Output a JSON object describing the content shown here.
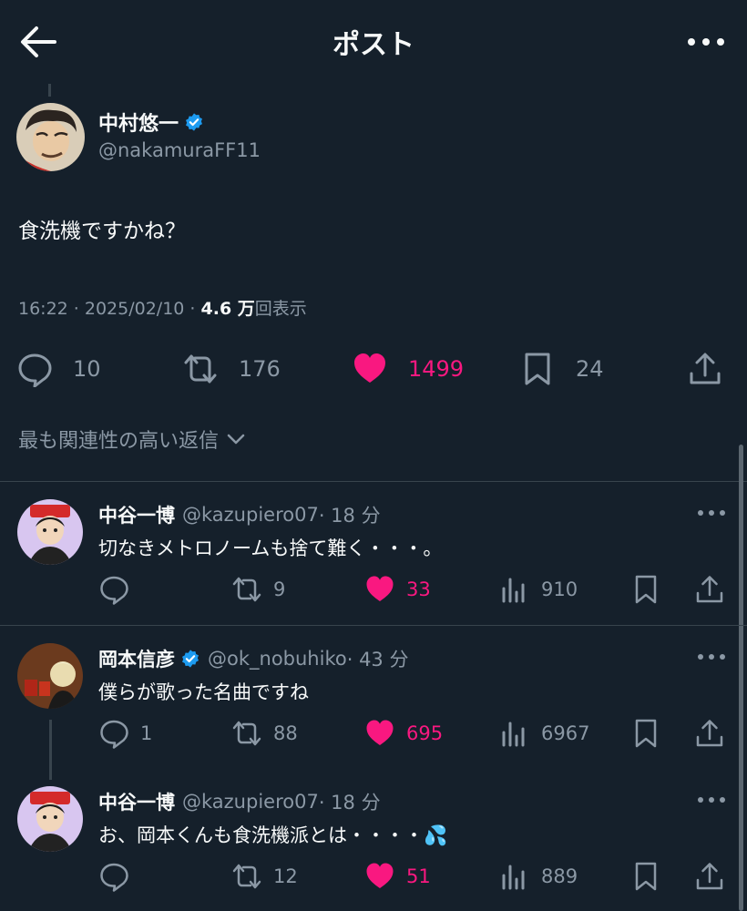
{
  "header": {
    "title": "ポスト"
  },
  "main_post": {
    "author_name": "中村悠一",
    "handle": "@nakamuraFF11",
    "text": "食洗機ですかね？",
    "time": "16:22 · 2025/02/10 · ",
    "views_value": "4.6 万",
    "views_label": "回表示",
    "replies": "10",
    "reposts": "176",
    "likes": "1499",
    "bookmarks": "24",
    "liked": true
  },
  "sort_label": "最も関連性の高い返信",
  "replies": [
    {
      "name": "中谷一博",
      "handle": "@kazupiero07",
      "time": "· 18 分",
      "text": "切なきメトロノームも捨て難く・・・。",
      "replies": "",
      "reposts": "9",
      "likes": "33",
      "views": "910",
      "verified": false
    },
    {
      "name": "岡本信彦",
      "handle": "@ok_nobuhiko",
      "time": "· 43 分",
      "text": "僕らが歌った名曲ですね",
      "replies": "1",
      "reposts": "88",
      "likes": "695",
      "views": "6967",
      "verified": true
    },
    {
      "name": "中谷一博",
      "handle": "@kazupiero07",
      "time": "· 18 分",
      "text": "お、岡本くんも食洗機派とは・・・・",
      "emoji": "💦",
      "replies": "",
      "reposts": "12",
      "likes": "51",
      "views": "889",
      "verified": false
    }
  ],
  "colors": {
    "background": "#15202b",
    "like": "#f91880",
    "verified": "#1d9bf0",
    "muted": "#8b98a5"
  }
}
